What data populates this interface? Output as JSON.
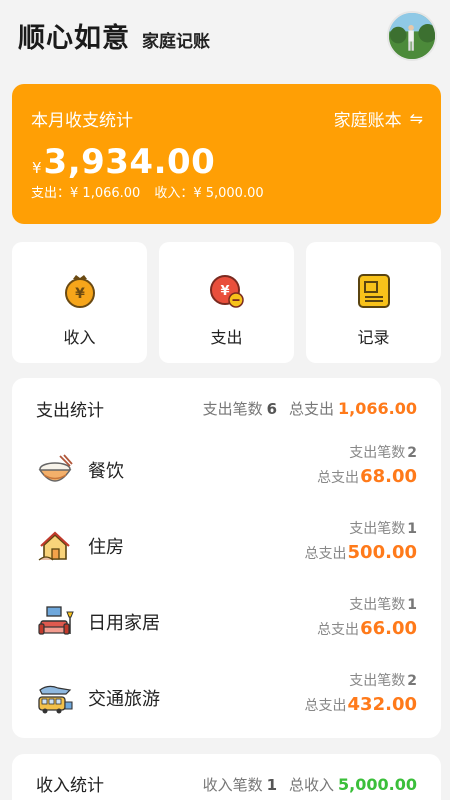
{
  "header": {
    "title": "顺心如意",
    "subtitle": "家庭记账",
    "avatar_icon": "user-avatar-photo"
  },
  "summary": {
    "title": "本月收支统计",
    "book_label": "家庭账本",
    "swap_icon": "⇋",
    "currency": "¥",
    "balance": "3,934.00",
    "expense_label": "支出：",
    "expense_value": "¥ 1,066.00",
    "income_label": "收入：",
    "income_value": "¥ 5,000.00",
    "color": "#ff9f05"
  },
  "actions": [
    {
      "label": "收入",
      "icon": "income-coin-icon"
    },
    {
      "label": "支出",
      "icon": "expense-coin-icon"
    },
    {
      "label": "记录",
      "icon": "record-book-icon"
    }
  ],
  "expense_stats": {
    "title": "支出统计",
    "count_label": "支出笔数",
    "count": "6",
    "total_label": "总支出",
    "total": "1,066.00",
    "items": [
      {
        "name": "餐饮",
        "icon": "rice-bowl-icon",
        "count_label": "支出笔数",
        "count": "2",
        "total_label": "总支出",
        "total": "68.00"
      },
      {
        "name": "住房",
        "icon": "house-icon",
        "count_label": "支出笔数",
        "count": "1",
        "total_label": "总支出",
        "total": "500.00"
      },
      {
        "name": "日用家居",
        "icon": "sofa-icon",
        "count_label": "支出笔数",
        "count": "1",
        "total_label": "总支出",
        "total": "66.00"
      },
      {
        "name": "交通旅游",
        "icon": "bus-icon",
        "count_label": "支出笔数",
        "count": "2",
        "total_label": "总支出",
        "total": "432.00"
      }
    ]
  },
  "income_stats": {
    "title": "收入统计",
    "count_label": "收入笔数",
    "count": "1",
    "total_label": "总收入",
    "total": "5,000.00"
  },
  "colors": {
    "accent_orange": "#ff9f05",
    "amount_orange": "#ff7a1a",
    "income_green": "#3bbf3a"
  }
}
